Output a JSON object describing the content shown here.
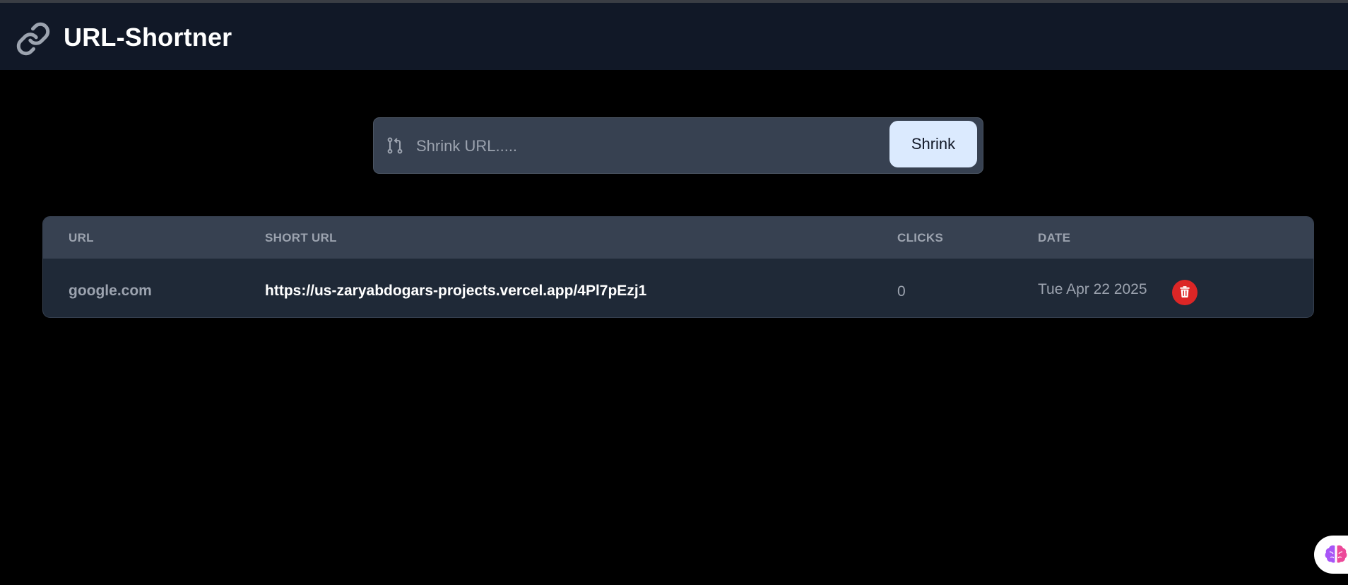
{
  "app": {
    "title": "URL-Shortner",
    "logo_icon": "link-icon"
  },
  "search": {
    "icon": "git-pull-request-icon",
    "placeholder": "Shrink URL.....",
    "value": "",
    "button_label": "Shrink"
  },
  "table": {
    "headers": {
      "url": "URL",
      "short_url": "SHORT URL",
      "clicks": "CLICKS",
      "date": "DATE"
    },
    "rows": [
      {
        "url": "google.com",
        "short_url": "https://us-zaryabdogars-projects.vercel.app/4Pl7pEzj1",
        "clicks": "0",
        "date": "Tue Apr 22 2025",
        "delete_icon": "trash-icon"
      }
    ]
  },
  "colors": {
    "navbar_bg": "#111827",
    "page_bg": "#000000",
    "input_bg": "#374151",
    "button_bg": "#dbeafe",
    "table_header_bg": "#374151",
    "table_row_bg": "#1f2937",
    "delete_red": "#dc2626"
  },
  "floating": {
    "assistant_icon": "brain-icon"
  }
}
